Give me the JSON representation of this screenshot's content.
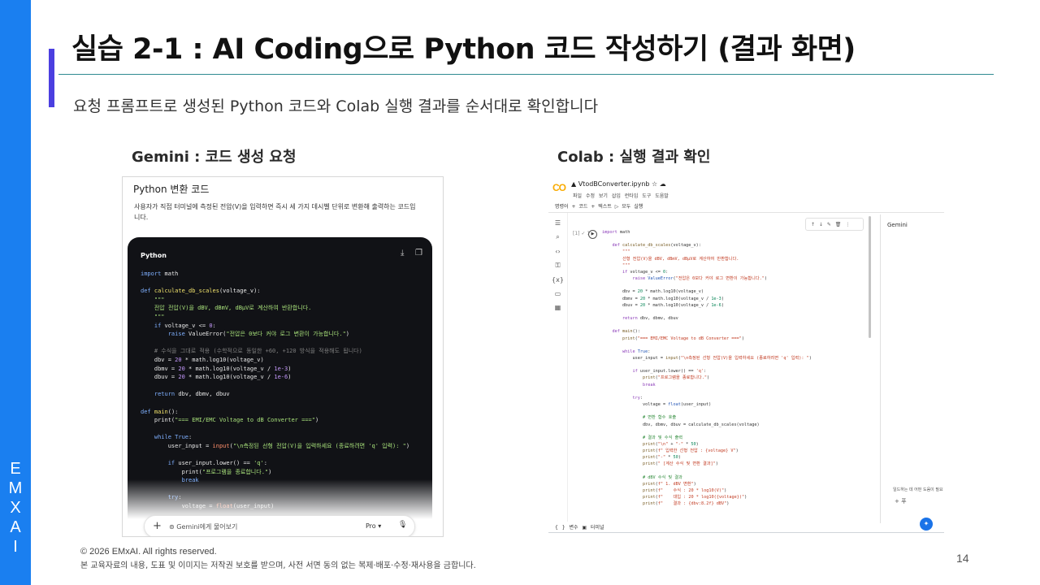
{
  "brand": {
    "letters": [
      "E",
      "M",
      "X",
      "A",
      "I"
    ]
  },
  "title": "실습 2-1 : AI Coding으로 Python 코드 작성하기 (결과 화면)",
  "subtitle": "요청 프롬프트로 생성된 Python 코드와 Colab 실행 결과를 순서대로 확인합니다",
  "gemini": {
    "label": "Gemini : 코드 생성 요청",
    "heading": "Python 변환 코드",
    "description": "사용자가 직접 터미널에 측정된 전압(V)을 입력하면 즉시 세 가지 데시벨 단위로 변환해 출력하는 코드입니다.",
    "code_lang": "Python",
    "download_icon": "download-icon",
    "copy_icon": "copy-icon",
    "ask_placeholder": "Gemini에게 물어보기",
    "model": "Pro",
    "mic_icon": "mic-icon"
  },
  "colab": {
    "label": "Colab : 실행 결과 확인",
    "filename": "VtodBConverter.ipynb",
    "menu": "파일 수정 보기 삽입 런타임 도구 도움말",
    "toolbar": "명령어 + 코드 + 텍스트 ▷ 모두 실행",
    "run_status": "[1] ✓ 18",
    "cell_tools": "↑ ↓ ✎ 🗑 ⋮",
    "side_panel_title": "Gemini",
    "side_hint": "일드하는 데 어떤 도움이 필요하세요",
    "side_hint_action": "+ 푸",
    "statusbar": "{ } 변수 ▣ 터미널"
  },
  "footer": {
    "copyright": "© 2026 EMxAI. All rights reserved.",
    "notice": "본 교육자료의 내용, 도표 및 이미지는 저작권 보호를 받으며, 사전 서면 동의 없는 복제·배포·수정·재사용을 금합니다."
  },
  "page_number": "14"
}
